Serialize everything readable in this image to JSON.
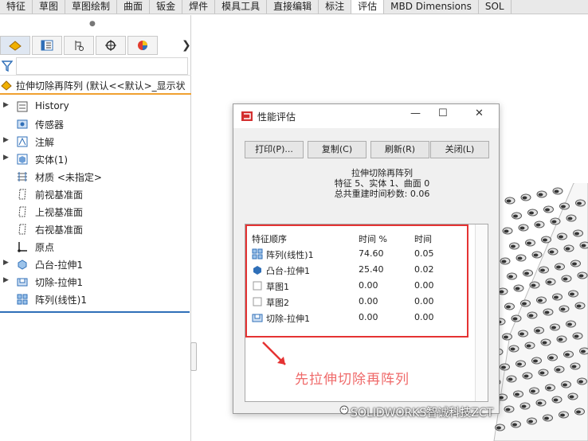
{
  "ribbon": {
    "tabs": [
      {
        "label": "特征",
        "active": false
      },
      {
        "label": "草图",
        "active": false
      },
      {
        "label": "草图绘制",
        "active": false
      },
      {
        "label": "曲面",
        "active": false
      },
      {
        "label": "钣金",
        "active": false
      },
      {
        "label": "焊件",
        "active": false
      },
      {
        "label": "模具工具",
        "active": false
      },
      {
        "label": "直接编辑",
        "active": false
      },
      {
        "label": "标注",
        "active": false
      },
      {
        "label": "评估",
        "active": true
      },
      {
        "label": "MBD Dimensions",
        "active": false
      },
      {
        "label": "SOL",
        "active": false
      }
    ]
  },
  "feature_manager": {
    "panel_tabs": [
      "feature-manager-icon",
      "property-manager-icon",
      "configuration-manager-icon",
      "dimxpert-icon",
      "display-manager-icon"
    ],
    "root": "拉伸切除再阵列 (默认<<默认>_显示状",
    "tree": [
      {
        "label": "History",
        "icon": "history-icon",
        "expandable": true
      },
      {
        "label": "传感器",
        "icon": "sensor-icon",
        "expandable": false
      },
      {
        "label": "注解",
        "icon": "annotation-icon",
        "expandable": true
      },
      {
        "label": "实体(1)",
        "icon": "solid-body-icon",
        "expandable": true
      },
      {
        "label": "材质 <未指定>",
        "icon": "material-icon",
        "expandable": false
      },
      {
        "label": "前视基准面",
        "icon": "plane-icon",
        "expandable": false
      },
      {
        "label": "上视基准面",
        "icon": "plane-icon",
        "expandable": false
      },
      {
        "label": "右视基准面",
        "icon": "plane-icon",
        "expandable": false
      },
      {
        "label": "原点",
        "icon": "origin-icon",
        "expandable": false
      },
      {
        "label": "凸台-拉伸1",
        "icon": "boss-extrude-icon",
        "expandable": true
      },
      {
        "label": "切除-拉伸1",
        "icon": "cut-extrude-icon",
        "expandable": true
      },
      {
        "label": "阵列(线性)1",
        "icon": "linear-pattern-icon",
        "expandable": false
      }
    ]
  },
  "dialog": {
    "title": "性能评估",
    "buttons": [
      "打印(P)...",
      "复制(C)",
      "刷新(R)",
      "关闭(L)"
    ],
    "summary": {
      "part_name": "拉伸切除再阵列",
      "counts": "特征 5、实体 1、曲面 0",
      "rebuild_time": "总共重建时间秒数: 0.06"
    },
    "columns": [
      "特征顺序",
      "时间 %",
      "时间"
    ],
    "rows": [
      {
        "name": "阵列(线性)1",
        "icon": "linear-pattern-icon",
        "pct": "74.60",
        "time": "0.05"
      },
      {
        "name": "凸台-拉伸1",
        "icon": "boss-extrude-icon",
        "pct": "25.40",
        "time": "0.02"
      },
      {
        "name": "草图1",
        "icon": "sketch-icon",
        "pct": "0.00",
        "time": "0.00"
      },
      {
        "name": "草图2",
        "icon": "sketch-icon",
        "pct": "0.00",
        "time": "0.00"
      },
      {
        "name": "切除-拉伸1",
        "icon": "cut-extrude-icon",
        "pct": "0.00",
        "time": "0.00"
      }
    ],
    "annotation": "先拉伸切除再阵列"
  },
  "watermark": "SOLIDWORKS智诚科技ZCT",
  "colors": {
    "highlight_box": "#e53333",
    "annotation_text": "#ef6a6a",
    "rollback_bar": "#2f6fb8",
    "root_underline": "#f0a030"
  }
}
